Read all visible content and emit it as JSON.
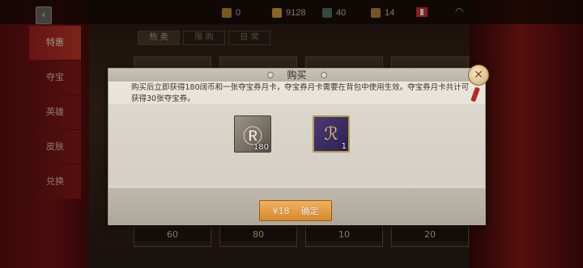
{
  "topbar": {
    "resources": [
      {
        "icon": "gold-coin-icon",
        "value": "0"
      },
      {
        "icon": "ingot-icon",
        "value": "9128"
      },
      {
        "icon": "clock-icon",
        "value": "40"
      },
      {
        "icon": "ticket-icon",
        "value": "14"
      }
    ]
  },
  "sidebar": {
    "items": [
      {
        "label": "特惠"
      },
      {
        "label": "夺宝"
      },
      {
        "label": "英雄"
      },
      {
        "label": "皮肤"
      },
      {
        "label": "兑换"
      }
    ]
  },
  "shop": {
    "tabs": [
      {
        "label": "热 卖"
      },
      {
        "label": "限 购"
      },
      {
        "label": "日 常"
      }
    ],
    "cards": [
      {
        "price": "60"
      },
      {
        "price": "80"
      },
      {
        "price": "10"
      },
      {
        "price": "20"
      }
    ]
  },
  "modal": {
    "title": "购买",
    "description": "购买后立即获得180阔币和一张夺宝券月卡，夺宝券月卡需要在背包中使用生效。夺宝券月卡共计可获得30张夺宝券。",
    "items": [
      {
        "icon": "ticket-item-icon",
        "count": "180"
      },
      {
        "icon": "monthly-card-icon",
        "count": "1"
      }
    ],
    "price": "¥18",
    "confirm_label": "确定"
  },
  "colors": {
    "accent": "#d8872d",
    "sidebar_active": "#c83a2a"
  }
}
